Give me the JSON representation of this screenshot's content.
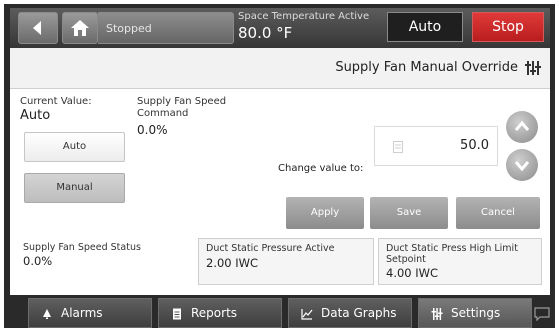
{
  "topbar": {
    "status": "Stopped",
    "temperature_label": "Space Temperature Active",
    "temperature_value": "80.0 °F",
    "auto_label": "Auto",
    "stop_label": "Stop"
  },
  "panel": {
    "title": "Supply Fan Manual Override",
    "current_value_label": "Current Value:",
    "current_value": "Auto",
    "speed_command_label": "Supply Fan Speed Command",
    "speed_command_value": "0.0%",
    "options": [
      "Auto",
      "Manual"
    ],
    "change_label": "Change value to:",
    "change_value": "50.0",
    "actions": {
      "apply": "Apply",
      "save": "Save",
      "cancel": "Cancel"
    }
  },
  "readouts": [
    {
      "label": "Supply Fan Speed Status",
      "value": "0.0%"
    },
    {
      "label": "Duct Static Pressure Active",
      "value": "2.00 IWC"
    },
    {
      "label": "Duct Static Press High Limit Setpoint",
      "value": "4.00 IWC"
    }
  ],
  "nav": [
    {
      "label": "Alarms",
      "icon": "bell-icon"
    },
    {
      "label": "Reports",
      "icon": "document-icon"
    },
    {
      "label": "Data Graphs",
      "icon": "chart-icon"
    },
    {
      "label": "Settings",
      "icon": "sliders-icon"
    }
  ],
  "colors": {
    "stop": "#c92525",
    "frame": "#2a2a2a",
    "selected_option": "#c9c9c9"
  }
}
